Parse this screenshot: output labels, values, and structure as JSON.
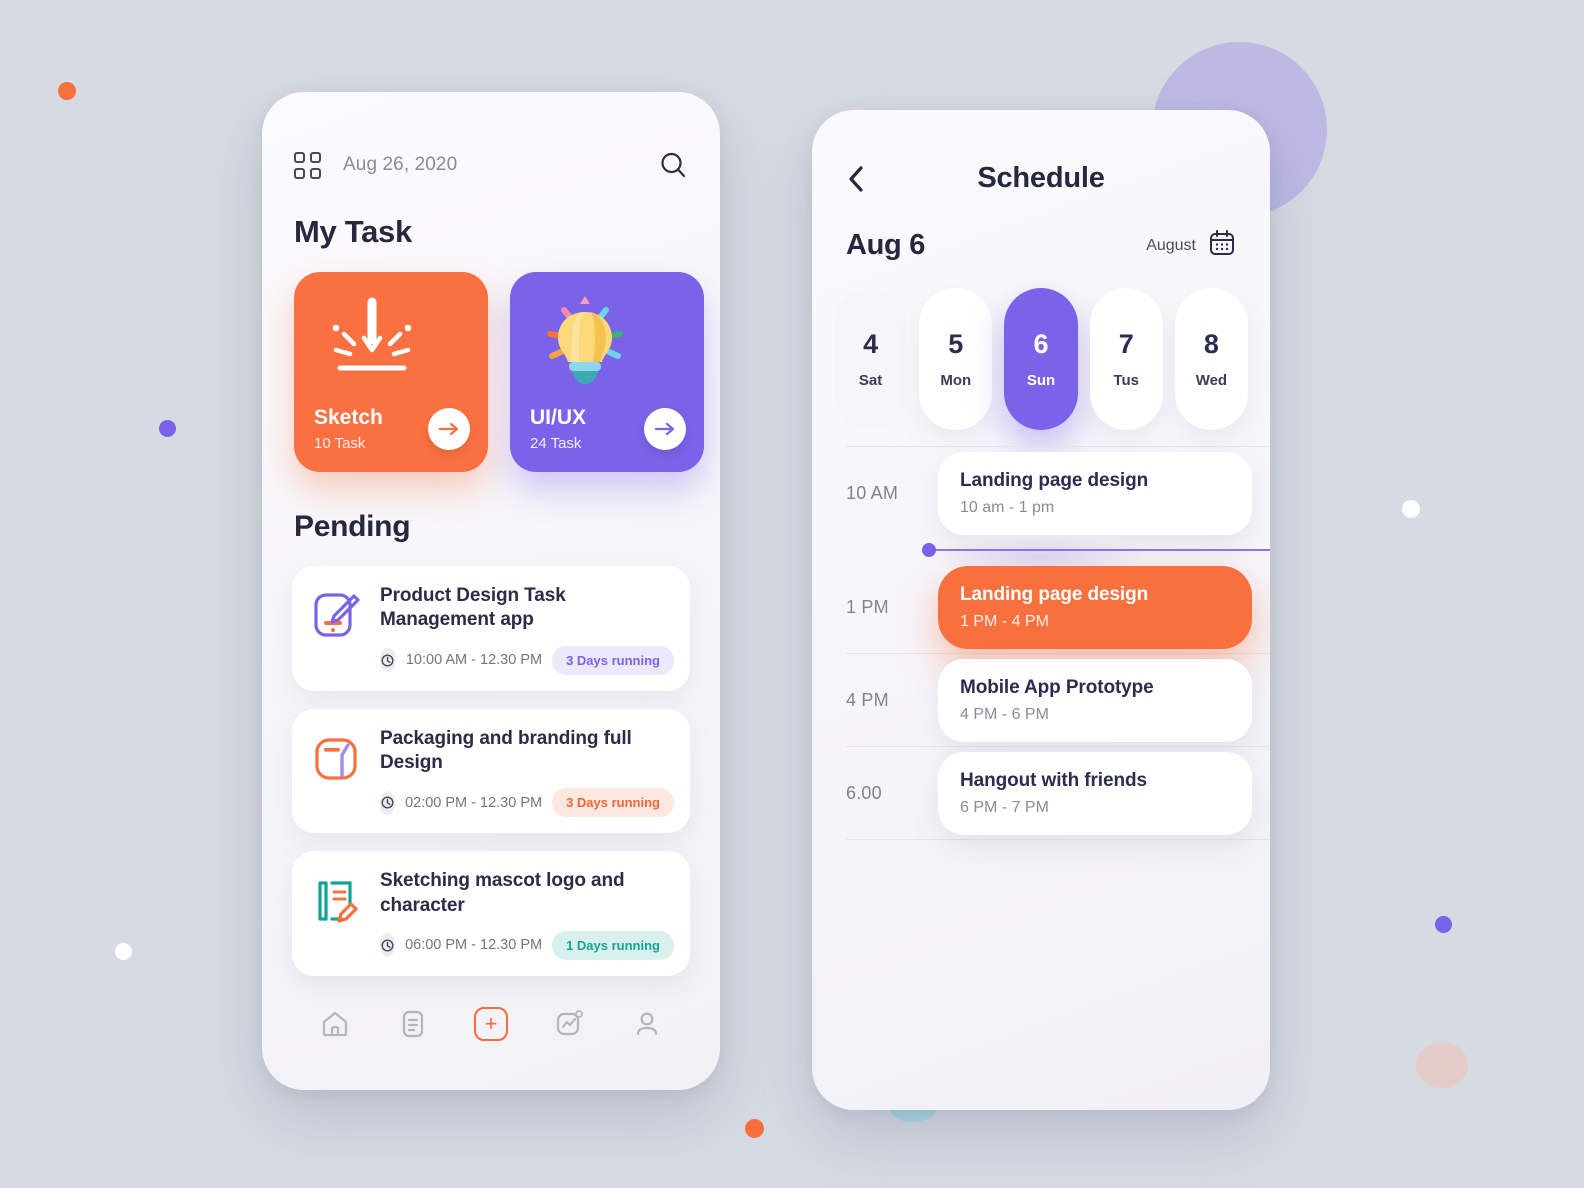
{
  "theme": {
    "page_bg": "#d6dae2",
    "orange": "#f97141",
    "purple": "#7a63e8",
    "dark_text": "#262840",
    "muted_text": "#8b8a97"
  },
  "left_phone": {
    "topbar": {
      "grid_icon": "grid-icon",
      "date": "Aug 26, 2020",
      "search_icon": "search-icon"
    },
    "my_task_heading": "My Task",
    "task_cards": [
      {
        "title": "Sketch",
        "subtitle": "10 Task",
        "color": "#f97141",
        "art": "pencil-sketch-icon",
        "arrow": "arrow-right-icon"
      },
      {
        "title": "UI/UX",
        "subtitle": "24 Task",
        "color": "#7a63e8",
        "art": "lightbulb-idea-icon",
        "arrow": "arrow-right-icon"
      }
    ],
    "pending_heading": "Pending",
    "pending": [
      {
        "title": "Product Design Task Management app",
        "time": "10:00 AM - 12.30 PM",
        "badge": "3 Days running",
        "badge_style": "violet",
        "icon": "note-edit-icon",
        "clock_icon": "clock-icon"
      },
      {
        "title": "Packaging and branding full Design",
        "time": "02:00 PM - 12.30 PM",
        "badge": "3 Days running",
        "badge_style": "peach",
        "icon": "package-box-icon",
        "clock_icon": "clock-icon"
      },
      {
        "title": "Sketching mascot logo and character",
        "time": "06:00 PM - 12.30 PM",
        "badge": "1 Days running",
        "badge_style": "mint",
        "icon": "document-pen-icon",
        "clock_icon": "clock-icon"
      }
    ],
    "tabbar": [
      {
        "icon": "home-icon",
        "active": false
      },
      {
        "icon": "document-list-icon",
        "active": false
      },
      {
        "icon": "plus-icon",
        "active": true
      },
      {
        "icon": "chart-stats-icon",
        "active": false
      },
      {
        "icon": "profile-person-icon",
        "active": false
      }
    ]
  },
  "right_phone": {
    "header": {
      "back_icon": "chevron-left-icon",
      "title": "Schedule"
    },
    "subheader": {
      "day_label": "Aug 6",
      "month_label": "August",
      "calendar_icon": "calendar-icon"
    },
    "days": [
      {
        "num": "4",
        "name": "Sat",
        "state": "dim"
      },
      {
        "num": "5",
        "name": "Mon",
        "state": "normal"
      },
      {
        "num": "6",
        "name": "Sun",
        "state": "active"
      },
      {
        "num": "7",
        "name": "Tus",
        "state": "normal"
      },
      {
        "num": "8",
        "name": "Wed",
        "state": "normal"
      }
    ],
    "slots": [
      {
        "time": "10 AM",
        "title": "Landing page design",
        "range": "10 am - 1 pm",
        "highlight": false
      },
      {
        "time": "1 PM",
        "title": "Landing page design",
        "range": "1 PM - 4 PM",
        "highlight": true
      },
      {
        "time": "4 PM",
        "title": "Mobile App Prototype",
        "range": "4 PM - 6 PM",
        "highlight": false
      },
      {
        "time": "6.00",
        "title": "Hangout with friends",
        "range": "6 PM - 7 PM",
        "highlight": false
      }
    ]
  }
}
